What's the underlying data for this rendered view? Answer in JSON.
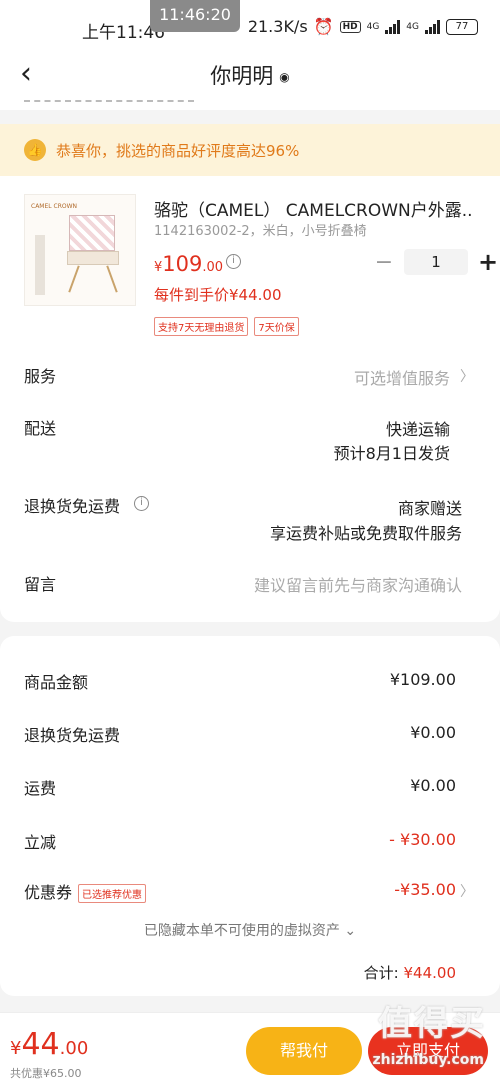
{
  "status": {
    "time": "上午11:46",
    "clock_pill": "11:46:20",
    "speed": "21.3K/s",
    "hd": "HD",
    "net1": "4G",
    "net2": "4G",
    "battery": "77"
  },
  "nav": {
    "title": "你明明"
  },
  "banner": {
    "text": "恭喜你，挑选的商品好评度高达96%"
  },
  "product": {
    "image_brand": "CAMEL CROWN",
    "title": "骆驼（CAMEL） CAMELCROWN户外露...",
    "sku": "1142163002-2，米白，小号折叠椅",
    "price_symbol": "¥",
    "price_big": "109",
    "price_small": ".00",
    "quantity": "1",
    "hand_price": "每件到手价¥44.00",
    "tags": [
      "支持7天无理由退货",
      "7天价保"
    ]
  },
  "rows": {
    "service_label": "服务",
    "service_value": "可选增值服务",
    "delivery_label": "配送",
    "delivery_value1": "快递运输",
    "delivery_value2": "预计8月1日发货",
    "return_label": "退换货免运费",
    "return_value1": "商家赠送",
    "return_value2": "享运费补贴或免费取件服务",
    "message_label": "留言",
    "message_placeholder": "建议留言前先与商家沟通确认"
  },
  "summary": {
    "goods_label": "商品金额",
    "goods_value": "¥109.00",
    "return_label": "退换货免运费",
    "return_value": "¥0.00",
    "shipping_label": "运费",
    "shipping_value": "¥0.00",
    "discount_label": "立减",
    "discount_value": "- ¥30.00",
    "coupon_label": "优惠券",
    "coupon_tag": "已选推荐优惠",
    "coupon_value": "-¥35.00",
    "hidden_note": "已隐藏本单不可使用的虚拟资产",
    "total_label": "合计:",
    "total_value": "¥44.00"
  },
  "bottom": {
    "total_symbol": "¥",
    "total_big": "44",
    "total_small": ".00",
    "saving": "共优惠¥65.00",
    "help_pay": "帮我付",
    "pay": "立即支付"
  },
  "watermark": {
    "main": "值得买",
    "sub": "zhizhibuy.com"
  },
  "colors": {
    "accent_red": "#e0301e",
    "help_yellow": "#f7b316",
    "banner_bg": "#fdf3d9"
  }
}
